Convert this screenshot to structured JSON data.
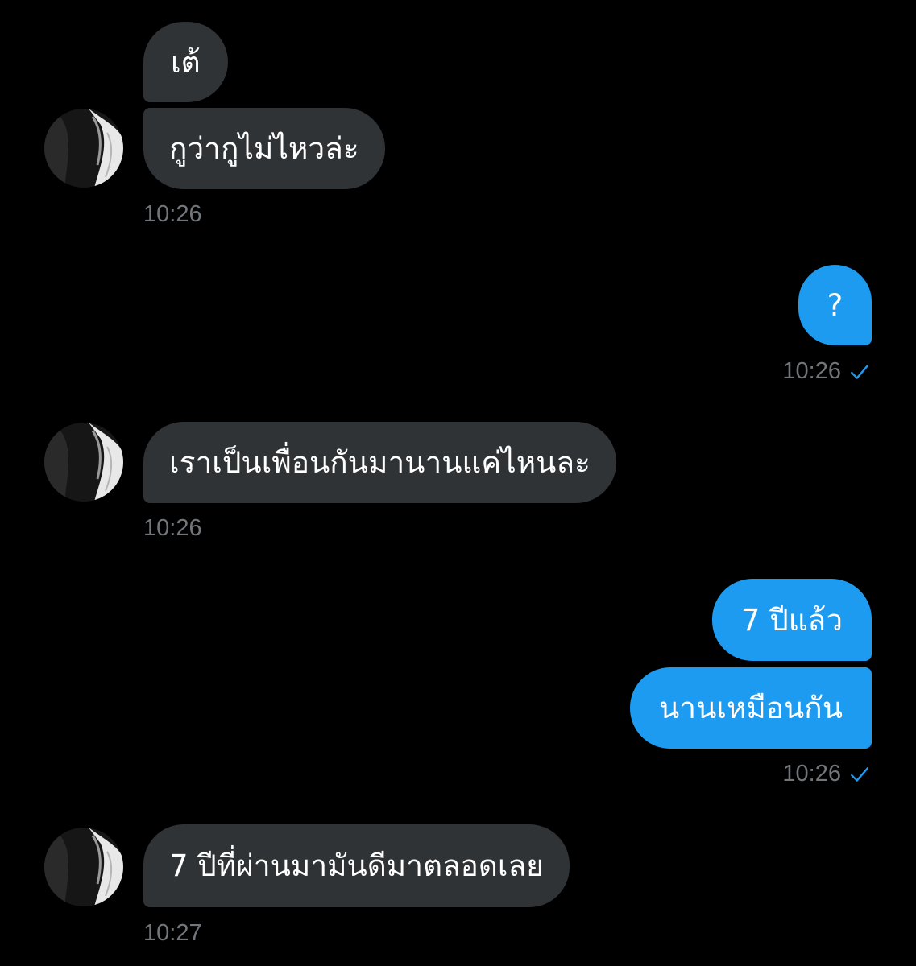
{
  "conversation": {
    "messages": [
      {
        "text": "เต้",
        "side": "incoming"
      },
      {
        "text": "กูว่ากูไม่ไหวล่ะ",
        "side": "incoming"
      },
      {
        "text": "?",
        "side": "outgoing"
      },
      {
        "text": "เราเป็นเพื่อนกันมานานแค่ไหนละ",
        "side": "incoming"
      },
      {
        "text": "7 ปีแล้ว",
        "side": "outgoing"
      },
      {
        "text": "นานเหมือนกัน",
        "side": "outgoing"
      },
      {
        "text": "7 ปีที่ผ่านมามันดีมาตลอดเลย",
        "side": "incoming"
      }
    ],
    "timestamps": [
      "10:26",
      "10:26",
      "10:26",
      "10:26",
      "10:27"
    ]
  },
  "colors": {
    "background": "#000000",
    "incoming_bubble": "#2f3336",
    "outgoing_bubble": "#1d9bf0",
    "timestamp": "#71767b",
    "read_check": "#1d9bf0"
  },
  "icons": {
    "read_receipt": "check-icon",
    "avatar": "avatar"
  }
}
